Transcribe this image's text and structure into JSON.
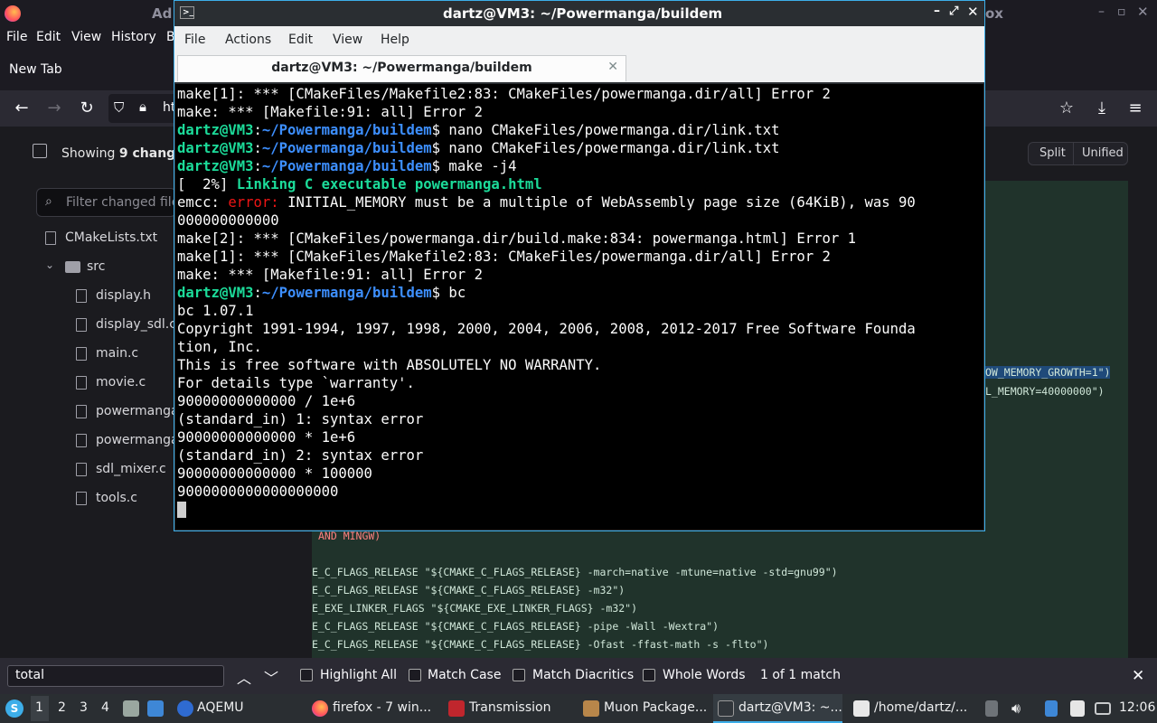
{
  "firefox": {
    "title_partial": "Ad",
    "title_right_partial": "ox",
    "menu": [
      "File",
      "Edit",
      "View",
      "History",
      "B"
    ],
    "tab_label": "New Tab",
    "url_partial": "ht",
    "diff": {
      "showing_prefix": "Showing ",
      "showing_count": "9",
      "showing_suffix": " changed",
      "filter_placeholder": "Filter changed files",
      "files": [
        {
          "name": "CMakeLists.txt",
          "type": "file",
          "indent": 0
        },
        {
          "name": "src",
          "type": "folder",
          "indent": 0
        },
        {
          "name": "display.h",
          "type": "file",
          "indent": 1
        },
        {
          "name": "display_sdl.c",
          "type": "file",
          "indent": 1
        },
        {
          "name": "main.c",
          "type": "file",
          "indent": 1
        },
        {
          "name": "movie.c",
          "type": "file",
          "indent": 1
        },
        {
          "name": "powermanga.c",
          "type": "file",
          "indent": 1
        },
        {
          "name": "powermanga.h",
          "type": "file",
          "indent": 1
        },
        {
          "name": "sdl_mixer.c",
          "type": "file",
          "indent": 1
        },
        {
          "name": "tools.c",
          "type": "file",
          "indent": 1
        }
      ],
      "view_split": "Split",
      "view_unified": "Unified",
      "code_right": [
        "OW_MEMORY_GROWTH=1\")",
        "L_MEMORY=40000000\")"
      ],
      "code_lines": [
        "AND MINGW)",
        "",
        "E_C_FLAGS_RELEASE \"${CMAKE_C_FLAGS_RELEASE} -march=native -mtune=native -std=gnu99\")",
        "E_C_FLAGS_RELEASE \"${CMAKE_C_FLAGS_RELEASE} -m32\")",
        "E_EXE_LINKER_FLAGS \"${CMAKE_EXE_LINKER_FLAGS} -m32\")",
        "E_C_FLAGS_RELEASE \"${CMAKE_C_FLAGS_RELEASE} -pipe -Wall -Wextra\")",
        "E_C_FLAGS_RELEASE \"${CMAKE_C_FLAGS_RELEASE} -Ofast -ffast-math -s -flto\")"
      ]
    },
    "findbar": {
      "value": "total",
      "highlight_all": "Highlight All",
      "match_case": "Match Case",
      "match_diacritics": "Match Diacritics",
      "whole_words": "Whole Words",
      "result": "1 of 1 match"
    }
  },
  "terminal": {
    "title": "dartz@VM3: ~/Powermanga/buildem",
    "menu": [
      "File",
      "Actions",
      "Edit",
      "View",
      "Help"
    ],
    "tab_title": "dartz@VM3: ~/Powermanga/buildem",
    "prompt_user": "dartz@VM3",
    "prompt_path": "~/Powermanga/buildem",
    "lines": [
      {
        "t": "plain",
        "text": "make[1]: *** [CMakeFiles/Makefile2:83: CMakeFiles/powermanga.dir/all] Error 2"
      },
      {
        "t": "plain",
        "text": "make: *** [Makefile:91: all] Error 2"
      },
      {
        "t": "prompt",
        "cmd": " nano CMakeFiles/powermanga.dir/link.txt"
      },
      {
        "t": "prompt",
        "cmd": " nano CMakeFiles/powermanga.dir/link.txt"
      },
      {
        "t": "prompt",
        "cmd": " make -j4"
      },
      {
        "t": "link",
        "pre": "[  2%] ",
        "text": "Linking C executable powermanga.html"
      },
      {
        "t": "error",
        "pre": "emcc: ",
        "err": "error:",
        "text": " INITIAL_MEMORY must be a multiple of WebAssembly page size (64KiB), was 90"
      },
      {
        "t": "plain",
        "text": "000000000000"
      },
      {
        "t": "plain",
        "text": "make[2]: *** [CMakeFiles/powermanga.dir/build.make:834: powermanga.html] Error 1"
      },
      {
        "t": "plain",
        "text": "make[1]: *** [CMakeFiles/Makefile2:83: CMakeFiles/powermanga.dir/all] Error 2"
      },
      {
        "t": "plain",
        "text": "make: *** [Makefile:91: all] Error 2"
      },
      {
        "t": "prompt",
        "cmd": " bc"
      },
      {
        "t": "plain",
        "text": "bc 1.07.1"
      },
      {
        "t": "plain",
        "text": "Copyright 1991-1994, 1997, 1998, 2000, 2004, 2006, 2008, 2012-2017 Free Software Founda"
      },
      {
        "t": "plain",
        "text": "tion, Inc."
      },
      {
        "t": "plain",
        "text": "This is free software with ABSOLUTELY NO WARRANTY."
      },
      {
        "t": "plain",
        "text": "For details type `warranty'."
      },
      {
        "t": "plain",
        "text": "90000000000000 / 1e+6"
      },
      {
        "t": "plain",
        "text": "(standard_in) 1: syntax error"
      },
      {
        "t": "plain",
        "text": "90000000000000 * 1e+6"
      },
      {
        "t": "plain",
        "text": "(standard_in) 2: syntax error"
      },
      {
        "t": "plain",
        "text": "90000000000000 * 100000"
      },
      {
        "t": "plain",
        "text": "9000000000000000000"
      }
    ]
  },
  "taskbar": {
    "desktops": [
      "1",
      "2",
      "3",
      "4"
    ],
    "items": [
      {
        "label": "AQEMU",
        "icon": "aqemu-icon"
      },
      {
        "label": "firefox - 7 win...",
        "icon": "firefox-icon"
      },
      {
        "label": "Transmission",
        "icon": "transmission-icon"
      },
      {
        "label": "Muon Package...",
        "icon": "package-icon"
      },
      {
        "label": "dartz@VM3: ~...",
        "icon": "terminal-icon"
      },
      {
        "label": "/home/dartz/...",
        "icon": "editor-icon"
      }
    ],
    "clock": "12:06"
  },
  "colors": {
    "terminal_prompt_green": "#1cdc9a",
    "terminal_path_blue": "#3d8fff",
    "terminal_error_red": "#ed1515",
    "accent_blue": "#3daee9"
  }
}
